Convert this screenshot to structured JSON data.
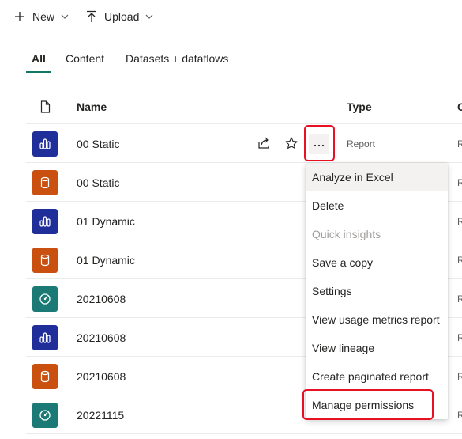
{
  "toolbar": {
    "new_label": "New",
    "upload_label": "Upload"
  },
  "tabs": [
    {
      "label": "All",
      "active": true
    },
    {
      "label": "Content",
      "active": false
    },
    {
      "label": "Datasets + dataflows",
      "active": false
    }
  ],
  "table": {
    "headers": {
      "name": "Name",
      "type": "Type",
      "extra": "C"
    },
    "rows": [
      {
        "name": "00 Static",
        "type": "Report",
        "kind": "report",
        "extra": "R"
      },
      {
        "name": "00 Static",
        "type": "",
        "kind": "dataset",
        "extra": "R"
      },
      {
        "name": "01 Dynamic",
        "type": "",
        "kind": "report",
        "extra": "R"
      },
      {
        "name": "01 Dynamic",
        "type": "",
        "kind": "dataset",
        "extra": "R"
      },
      {
        "name": "20210608",
        "type": "",
        "kind": "dashboard",
        "extra": "R"
      },
      {
        "name": "20210608",
        "type": "",
        "kind": "report",
        "extra": "R"
      },
      {
        "name": "20210608",
        "type": "",
        "kind": "dataset",
        "extra": "R"
      },
      {
        "name": "20221115",
        "type": "",
        "kind": "dashboard",
        "extra": "R"
      }
    ]
  },
  "context_menu": {
    "items": [
      {
        "label": "Analyze in Excel",
        "state": "hover"
      },
      {
        "label": "Delete",
        "state": "normal"
      },
      {
        "label": "Quick insights",
        "state": "disabled"
      },
      {
        "label": "Save a copy",
        "state": "normal"
      },
      {
        "label": "Settings",
        "state": "normal"
      },
      {
        "label": "View usage metrics report",
        "state": "normal"
      },
      {
        "label": "View lineage",
        "state": "normal"
      },
      {
        "label": "Create paginated report",
        "state": "normal"
      },
      {
        "label": "Manage permissions",
        "state": "normal"
      }
    ]
  },
  "colors": {
    "report": "#1f2e99",
    "dataset": "#ca5010",
    "dashboard": "#1b7a75",
    "accent": "#117865",
    "highlight": "#e81123"
  }
}
